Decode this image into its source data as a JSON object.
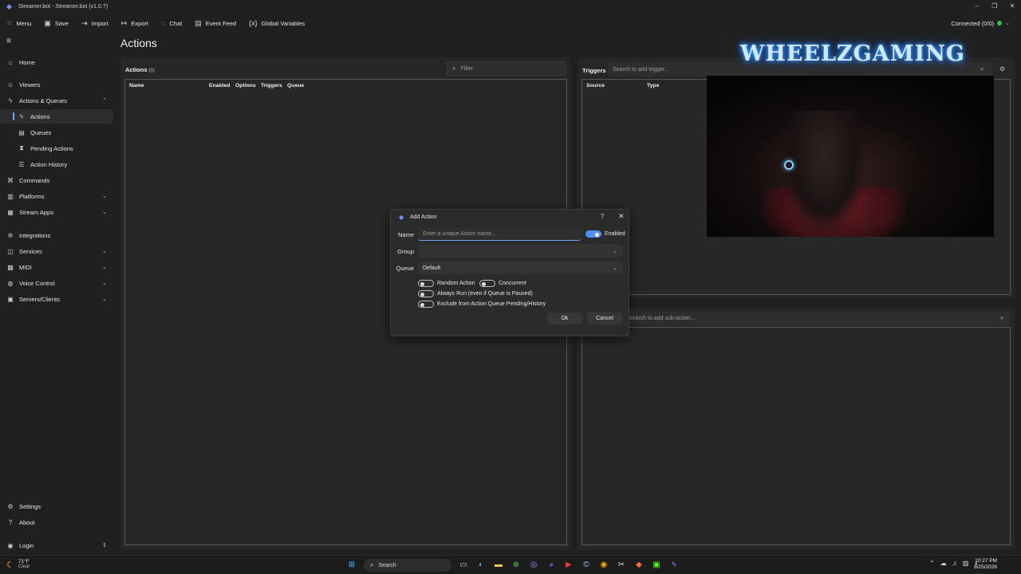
{
  "window": {
    "title": "Streamer.bot - Streamer.bot (v1.0.?)",
    "controls": [
      "–",
      "❐",
      "✕"
    ]
  },
  "toolbar": {
    "items": [
      {
        "label": "Menu",
        "icon": "grid-icon"
      },
      {
        "label": "Save",
        "icon": "save-icon"
      },
      {
        "label": "Import",
        "icon": "import-icon"
      },
      {
        "label": "Export",
        "icon": "export-icon"
      },
      {
        "label": "Chat",
        "icon": "chat-icon"
      },
      {
        "label": "Event Feed",
        "icon": "feed-icon"
      },
      {
        "label": "Global Variables",
        "icon": "variables-icon"
      }
    ],
    "connection": "Connected (0/0)"
  },
  "sidebar": {
    "items": [
      {
        "label": "Home",
        "icon": "home-icon"
      },
      {
        "label": "Viewers",
        "icon": "users-icon"
      },
      {
        "label": "Actions & Queues",
        "icon": "bolt-icon"
      },
      {
        "label": "Actions",
        "icon": "action-icon"
      },
      {
        "label": "Queues",
        "icon": "queue-icon"
      },
      {
        "label": "Pending Actions",
        "icon": "pending-icon"
      },
      {
        "label": "Action History",
        "icon": "history-icon"
      },
      {
        "label": "Commands",
        "icon": "command-icon"
      },
      {
        "label": "Platforms",
        "icon": "platform-icon"
      },
      {
        "label": "Stream Apps",
        "icon": "apps-icon"
      },
      {
        "label": "Integrations",
        "icon": "integration-icon"
      },
      {
        "label": "Services",
        "icon": "services-icon"
      },
      {
        "label": "MIDI",
        "icon": "midi-icon"
      },
      {
        "label": "Voice Control",
        "icon": "voice-icon"
      },
      {
        "label": "Servers/Clients",
        "icon": "server-icon"
      },
      {
        "label": "Settings",
        "icon": "gear-icon"
      },
      {
        "label": "About",
        "icon": "question-icon"
      },
      {
        "label": "Login",
        "icon": "login-icon"
      }
    ]
  },
  "main": {
    "title": "Actions",
    "actions_panel": {
      "label": "Actions",
      "count": "(0)",
      "filter_placeholder": "Filter",
      "columns": [
        "Name",
        "Enabled",
        "Options",
        "Triggers",
        "Queue"
      ]
    },
    "triggers_panel": {
      "label": "Triggers",
      "search_placeholder": "Search to add trigger...",
      "columns": [
        "Source",
        "Type"
      ]
    },
    "subactions_panel": {
      "search_placeholder": "Search to add sub-action..."
    }
  },
  "overlay": {
    "brand_text": "WHEELZGAMING"
  },
  "dialog": {
    "title": "Add Action",
    "help": "?",
    "close": "✕",
    "name_label": "Name",
    "name_placeholder": "Enter a unique Action name...",
    "enabled_label": "Enabled",
    "enabled": true,
    "group_label": "Group",
    "group_value": "",
    "queue_label": "Queue",
    "queue_value": "Default",
    "options": [
      {
        "label": "Random Action",
        "on": false
      },
      {
        "label": "Concurrent",
        "on": false
      },
      {
        "label": "Always Run (even if Queue is Paused)",
        "on": false
      },
      {
        "label": "Exclude from Action Queue Pending/History",
        "on": false
      }
    ],
    "ok_label": "Ok",
    "cancel_label": "Cancel"
  },
  "taskbar": {
    "weather_temp": "71°F",
    "weather_desc": "Clear",
    "search_label": "Search",
    "time": "10:27 PM",
    "date": "8/25/2026",
    "accent": "#4f8ff7"
  }
}
